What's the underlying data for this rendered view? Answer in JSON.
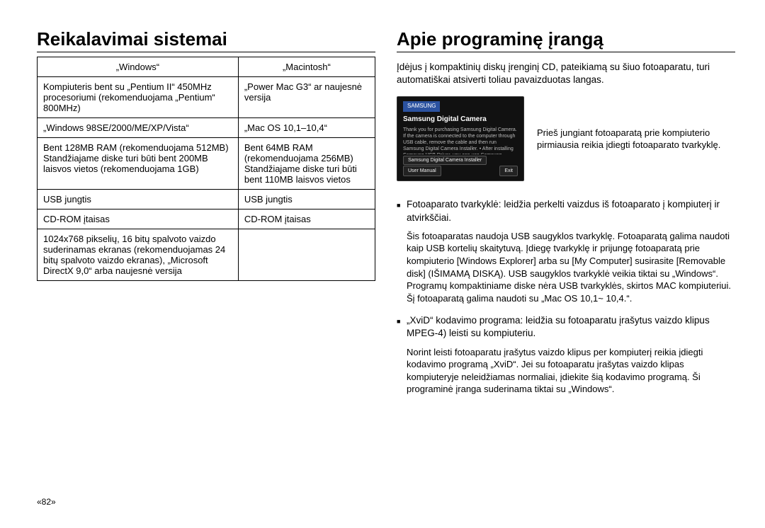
{
  "left": {
    "heading": "Reikalavimai sistemai",
    "table": {
      "headers": [
        "„Windows“",
        "„Macintosh“"
      ],
      "rows": [
        [
          "Kompiuteris bent su „Pentium II“ 450MHz  procesoriumi (rekomenduojama „Pentium“ 800MHz)",
          "„Power Mac G3“ ar naujesnė versija"
        ],
        [
          "„Windows 98SE/2000/ME/XP/Vista“",
          "„Mac OS 10,1–10,4“"
        ],
        [
          "Bent 128MB RAM (rekomenduojama 512MB) Standžiajame diske turi būti bent 200MB laisvos vietos (rekomenduojama 1GB)",
          "Bent 64MB RAM (rekomenduojama 256MB) Standžiajame diske turi būti bent 110MB laisvos vietos"
        ],
        [
          "USB jungtis",
          "USB jungtis"
        ],
        [
          "CD-ROM įtaisas",
          "CD-ROM įtaisas"
        ],
        [
          "1024x768 pikselių, 16 bitų spalvoto vaizdo suderinamas ekranas (rekomenduojamas 24 bitų spalvoto vaizdo ekranas), „Microsoft DirectX 9,0“ arba naujesnė versija",
          ""
        ]
      ]
    }
  },
  "right": {
    "heading": "Apie programinę įrangą",
    "intro": "Įdėjus į kompaktinių diskų įrenginį CD, pateikiamą su šiuo fotoaparatu, turi automatiškai atsiverti toliau pavaizduotas langas.",
    "fig": {
      "brand": "SAMSUNG",
      "title": "Samsung Digital Camera",
      "body": "Thank you for purchasing Samsung Digital Camera. If the camera is connected to the computer through USB cable, remove the cable and then run Samsung Digital Camera Installer. • After installing Samsung USB Driver, you can use Samsung Master. • This CD-ROM includes User Manual in PDF file.",
      "btn_installer": "Samsung Digital Camera Installer",
      "btn_manual": "User Manual",
      "btn_exit": "Exit"
    },
    "fig_side_text": "Prieš jungiant fotoaparatą prie kompiuterio pirmiausia reikia įdiegti fotoaparato tvarkyklę.",
    "bullet1": "Fotoaparato tvarkyklė:  leidžia perkelti vaizdus iš fotoaparato į kompiuterį ir atvirkščiai.",
    "sub1": "Šis fotoaparatas naudoja USB saugyklos tvarkyklę. Fotoaparatą galima naudoti kaip USB kortelių skaitytuvą. Įdiegę tvarkyklę ir prijungę fotoaparatą prie kompiuterio [Windows Explorer] arba su [My Computer] susirasite [Removable disk] (IŠIMAMĄ DISKĄ). USB saugyklos tvarkyklė veikia tiktai su „Windows“. Programų kompaktiniame diske nėra USB tvarkyklės, skirtos MAC kompiuteriui. Šį fotoaparatą galima naudoti su „Mac OS 10,1~ 10,4.“.",
    "bullet2": "„XviD“ kodavimo programa: leidžia su fotoaparatu įrašytus vaizdo klipus MPEG-4) leisti su kompiuteriu.",
    "sub2": "Norint leisti fotoaparatu įrašytus vaizdo klipus per kompiuterį reikia įdiegti kodavimo programą „XviD“. Jei su fotoaparatu įrašytas vaizdo klipas kompiuteryje neleidžiamas normaliai, įdiekite šią kodavimo programą. Ši programinė įranga suderinama tiktai su „Windows“."
  },
  "page_number": "«82»"
}
